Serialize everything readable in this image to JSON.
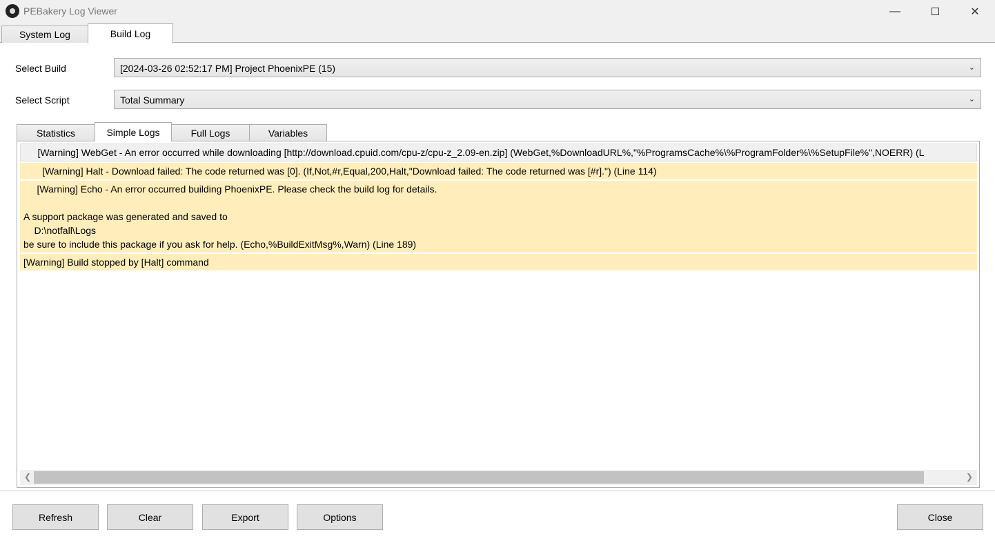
{
  "window": {
    "title": "PEBakery Log Viewer"
  },
  "main_tabs": [
    {
      "label": "System Log"
    },
    {
      "label": "Build Log"
    }
  ],
  "select_build": {
    "label": "Select Build",
    "value": "[2024-03-26 02:52:17 PM] Project PhoenixPE (15)"
  },
  "select_script": {
    "label": "Select Script",
    "value": "Total Summary"
  },
  "sub_tabs": [
    {
      "label": "Statistics"
    },
    {
      "label": "Simple Logs"
    },
    {
      "label": "Full Logs"
    },
    {
      "label": "Variables"
    }
  ],
  "logs": [
    "     [Warning] WebGet - An error occurred while downloading [http://download.cpuid.com/cpu-z/cpu-z_2.09-en.zip] (WebGet,%DownloadURL%,\"%ProgramsCache%\\%ProgramFolder%\\%SetupFile%\",NOERR) (L",
    "       [Warning] Halt - Download failed: The code returned was [0]. (If,Not,#r,Equal,200,Halt,\"Download failed: The code returned was [#r].\") (Line 114)",
    "     [Warning] Echo - An error occurred building PhoenixPE. Please check the build log for details.\n\nA support package was generated and saved to\n    D:\\notfall\\Logs\nbe sure to include this package if you ask for help. (Echo,%BuildExitMsg%,Warn) (Line 189)",
    "[Warning] Build stopped by [Halt] command"
  ],
  "buttons": {
    "refresh": "Refresh",
    "clear": "Clear",
    "export": "Export",
    "options": "Options",
    "close": "Close"
  },
  "colors": {
    "warning_row": "#ffeebb",
    "selected_row": "#f0f0f0"
  }
}
